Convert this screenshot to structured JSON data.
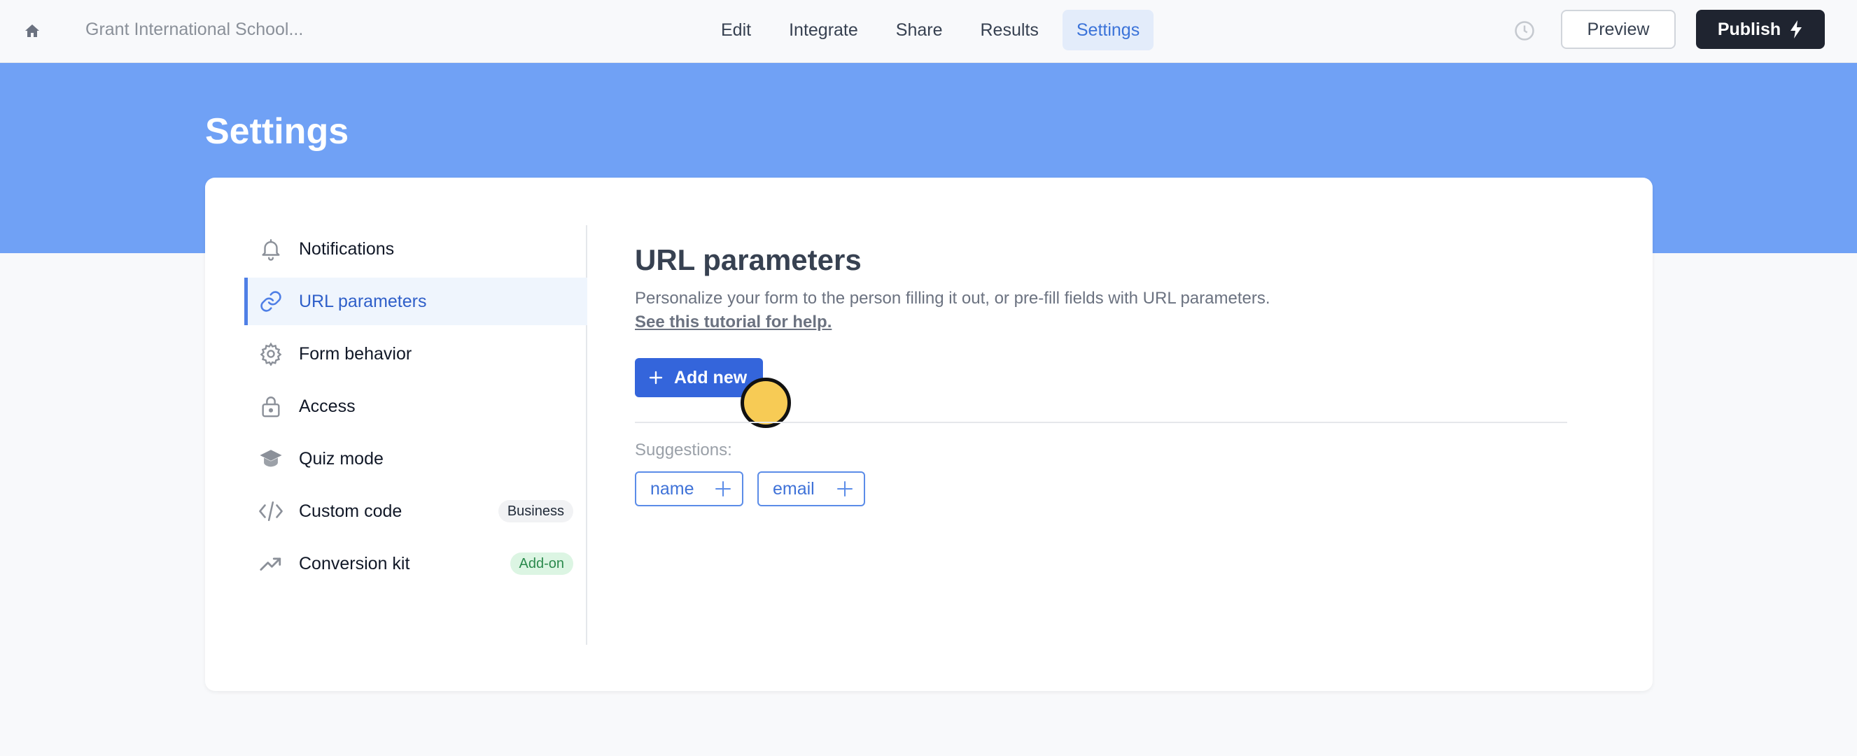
{
  "topbar": {
    "form_title": "Grant International School...",
    "tabs": [
      {
        "label": "Edit",
        "active": false
      },
      {
        "label": "Integrate",
        "active": false
      },
      {
        "label": "Share",
        "active": false
      },
      {
        "label": "Results",
        "active": false
      },
      {
        "label": "Settings",
        "active": true
      }
    ],
    "preview_label": "Preview",
    "publish_label": "Publish"
  },
  "hero": {
    "title": "Settings"
  },
  "sidebar": {
    "items": [
      {
        "label": "Notifications",
        "icon": "bell-icon",
        "active": false
      },
      {
        "label": "URL parameters",
        "icon": "link-icon",
        "active": true
      },
      {
        "label": "Form behavior",
        "icon": "gear-icon",
        "active": false
      },
      {
        "label": "Access",
        "icon": "lock-icon",
        "active": false
      },
      {
        "label": "Quiz mode",
        "icon": "graduation-cap-icon",
        "active": false
      },
      {
        "label": "Custom code",
        "icon": "code-icon",
        "active": false,
        "badge": "Business"
      },
      {
        "label": "Conversion kit",
        "icon": "trending-up-icon",
        "active": false,
        "badge": "Add-on"
      }
    ]
  },
  "main": {
    "title": "URL parameters",
    "description": "Personalize your form to the person filling it out, or pre-fill fields with URL parameters.",
    "tutorial_link": "See this tutorial for help.",
    "add_button": "Add new",
    "suggestions_label": "Suggestions:",
    "suggestions": [
      "name",
      "email"
    ]
  },
  "colors": {
    "accent": "#3465db",
    "hero_bg": "#70a1f5",
    "active_tab_bg": "#e3ecfa",
    "publish_bg": "#1f2430",
    "addon_badge_bg": "#dcf5e3",
    "cursor_marker": "#f7cb55"
  }
}
